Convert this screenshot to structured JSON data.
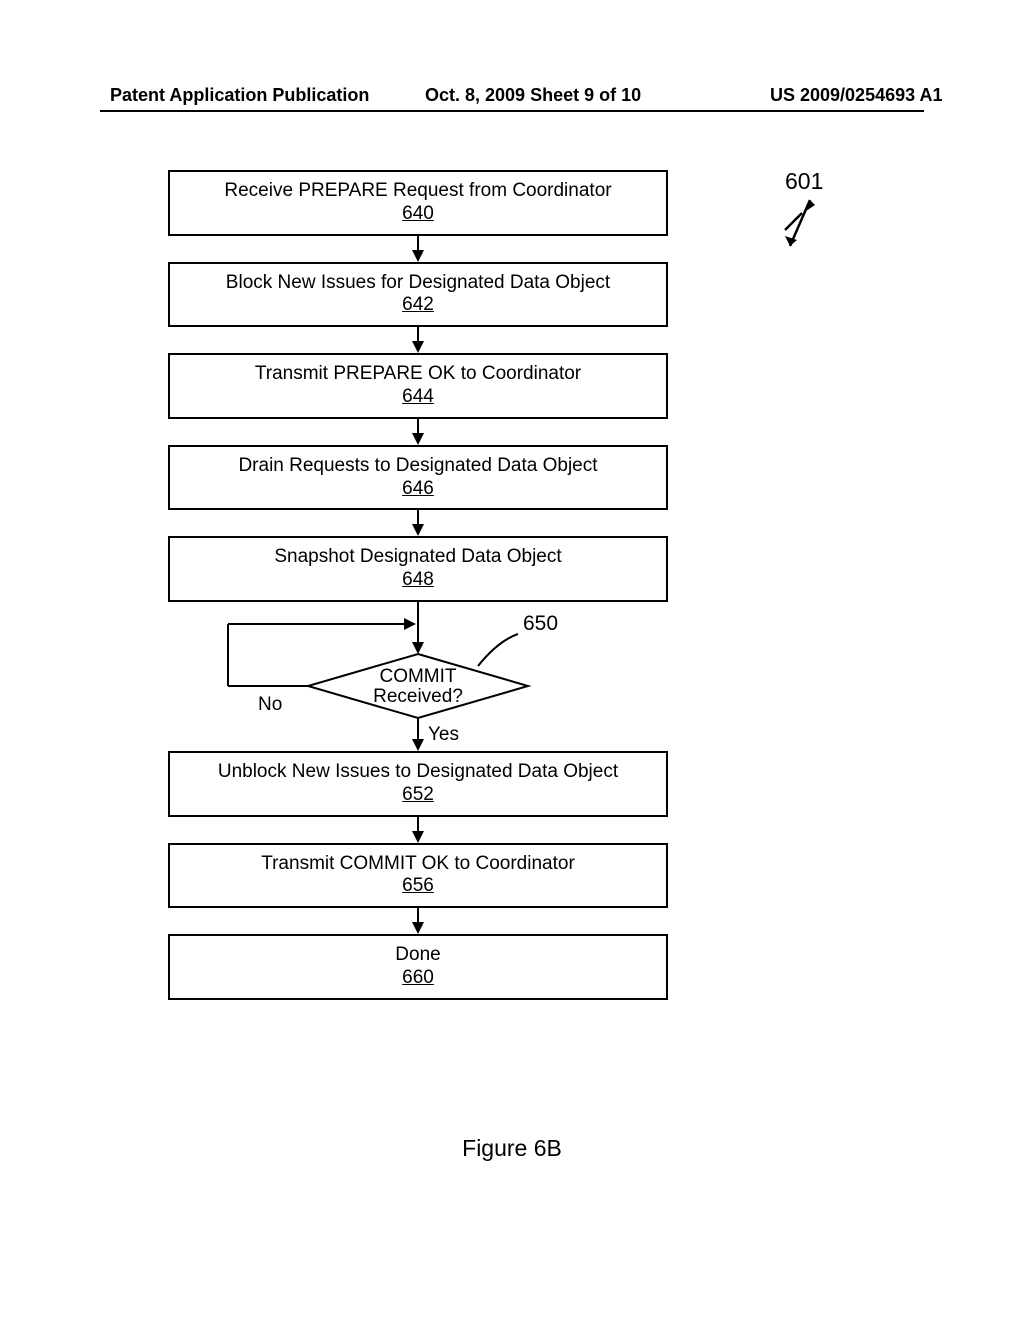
{
  "header": {
    "left": "Patent Application Publication",
    "center": "Oct. 8, 2009  Sheet 9 of 10",
    "right": "US 2009/0254693 A1"
  },
  "reference": {
    "label": "601"
  },
  "steps": {
    "s640": {
      "text": "Receive PREPARE Request from Coordinator",
      "num": "640"
    },
    "s642": {
      "text": "Block New Issues for Designated Data Object",
      "num": "642"
    },
    "s644": {
      "text": "Transmit PREPARE OK to Coordinator",
      "num": "644"
    },
    "s646": {
      "text": "Drain Requests to Designated Data Object",
      "num": "646"
    },
    "s648": {
      "text": "Snapshot Designated Data Object",
      "num": "648"
    },
    "decision": {
      "line1": "COMMIT",
      "line2": "Received?",
      "num": "650",
      "yes": "Yes",
      "no": "No"
    },
    "s652": {
      "text": "Unblock New Issues to Designated Data Object",
      "num": "652"
    },
    "s656": {
      "text": "Transmit COMMIT OK to Coordinator",
      "num": "656"
    },
    "s660": {
      "text": "Done",
      "num": "660"
    }
  },
  "figure_label": "Figure 6B"
}
